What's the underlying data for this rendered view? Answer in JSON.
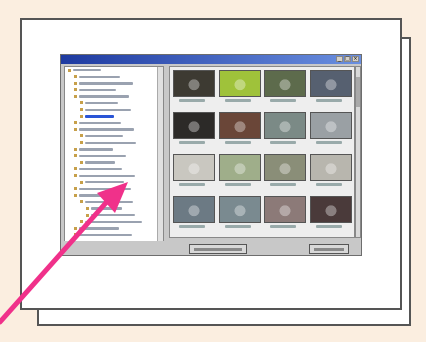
{
  "scene": {
    "background_color": "#fbeee0",
    "arrow_color": "#f0318a"
  },
  "window": {
    "title": "",
    "titlebar_color": "#1e3aa0",
    "controls": [
      "minimize-icon",
      "maximize-icon",
      "close-icon"
    ]
  },
  "tree": {
    "items": [
      {
        "label": "",
        "indent": 0,
        "selected": false
      },
      {
        "label": "",
        "indent": 1,
        "selected": false
      },
      {
        "label": "",
        "indent": 1,
        "selected": false
      },
      {
        "label": "",
        "indent": 1,
        "selected": false
      },
      {
        "label": "",
        "indent": 1,
        "selected": false
      },
      {
        "label": "",
        "indent": 2,
        "selected": false
      },
      {
        "label": "",
        "indent": 2,
        "selected": false
      },
      {
        "label": "",
        "indent": 2,
        "selected": true
      },
      {
        "label": "",
        "indent": 1,
        "selected": false
      },
      {
        "label": "",
        "indent": 1,
        "selected": false
      },
      {
        "label": "",
        "indent": 2,
        "selected": false
      },
      {
        "label": "",
        "indent": 2,
        "selected": false
      },
      {
        "label": "",
        "indent": 1,
        "selected": false
      },
      {
        "label": "",
        "indent": 1,
        "selected": false
      },
      {
        "label": "",
        "indent": 2,
        "selected": false
      },
      {
        "label": "",
        "indent": 1,
        "selected": false
      },
      {
        "label": "",
        "indent": 1,
        "selected": false
      },
      {
        "label": "",
        "indent": 2,
        "selected": false
      },
      {
        "label": "",
        "indent": 1,
        "selected": false
      },
      {
        "label": "",
        "indent": 1,
        "selected": false
      },
      {
        "label": "",
        "indent": 2,
        "selected": false
      },
      {
        "label": "",
        "indent": 3,
        "selected": false
      },
      {
        "label": "",
        "indent": 3,
        "selected": false
      },
      {
        "label": "",
        "indent": 2,
        "selected": false
      },
      {
        "label": "",
        "indent": 1,
        "selected": false
      },
      {
        "label": "",
        "indent": 1,
        "selected": false
      }
    ]
  },
  "thumbnails": [
    {
      "caption": "",
      "color": "#3d3a32"
    },
    {
      "caption": "",
      "color": "#9fc23a"
    },
    {
      "caption": "",
      "color": "#5d6b4c"
    },
    {
      "caption": "",
      "color": "#566070"
    },
    {
      "caption": "",
      "color": "#2c2a28"
    },
    {
      "caption": "",
      "color": "#6a4638"
    },
    {
      "caption": "",
      "color": "#7b8a86"
    },
    {
      "caption": "",
      "color": "#9aa0a4"
    },
    {
      "caption": "",
      "color": "#c9c7c0"
    },
    {
      "caption": "",
      "color": "#9fae8a"
    },
    {
      "caption": "",
      "color": "#8a8e78"
    },
    {
      "caption": "",
      "color": "#b8b6ae"
    },
    {
      "caption": "",
      "color": "#6c7a84"
    },
    {
      "caption": "",
      "color": "#7a8a90"
    },
    {
      "caption": "",
      "color": "#8c7a78"
    },
    {
      "caption": "",
      "color": "#4a3a3a"
    }
  ],
  "buttons": {
    "center_label": "",
    "right_label": ""
  }
}
